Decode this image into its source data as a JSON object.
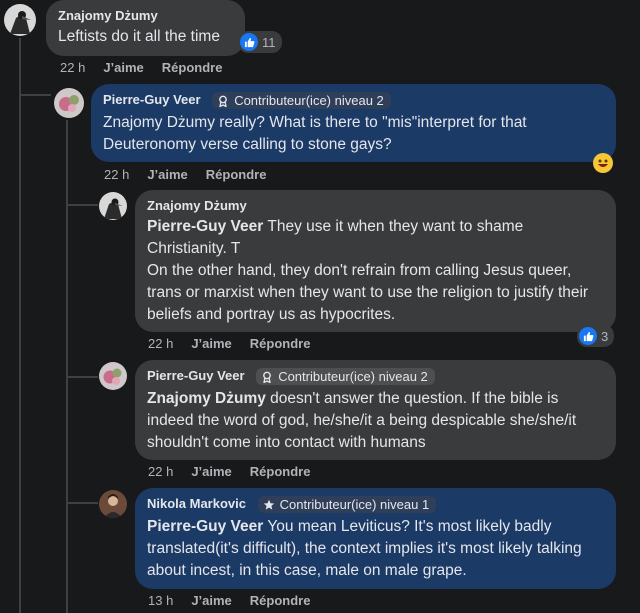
{
  "comments": [
    {
      "author": "Znajomy Dżumy",
      "text": "Leftists do it all the time",
      "time": "22 h",
      "like": "J’aime",
      "reply": "Répondre",
      "reactions": "11"
    },
    {
      "author": "Pierre-Guy Veer",
      "badge": "Contributeur(ice) niveau 2",
      "text": "Znajomy Dżumy really? What is there to \"mis\"interpret for that Deuteronomy verse calling to stone gays?",
      "time": "22 h",
      "like": "J’aime",
      "reply": "Répondre"
    },
    {
      "author": "Znajomy Dżumy",
      "mention": "Pierre-Guy Veer",
      "text_line1": " They use it when they want to shame Christianity. T",
      "text_line2": "On the other hand, they don't refrain from calling Jesus queer, trans or marxist when they want to use the religion to justify their beliefs and portray us as hypocrites.",
      "time": "22 h",
      "like": "J’aime",
      "reply": "Répondre",
      "reactions": "3"
    },
    {
      "author": "Pierre-Guy Veer",
      "badge": "Contributeur(ice) niveau 2",
      "mention": "Znajomy Dżumy",
      "text": " doesn't answer the question. If the bible is indeed the word of god, he/she/it a being despicable she/she/it shouldn't come into contact with humans",
      "time": "22 h",
      "like": "J’aime",
      "reply": "Répondre"
    },
    {
      "author": "Nikola Markovic",
      "badge": "Contributeur(ice) niveau 1",
      "mention": "Pierre-Guy Veer",
      "text": " You mean Leviticus? It's most likely badly translated(it's difficult), the context implies it's most likely talking about incest, in this case, male on male grape.",
      "time": "13 h",
      "like": "J’aime",
      "reply": "Répondre"
    }
  ],
  "colors": {
    "background": "#18191a",
    "bubble_dark": "#3a3b3c",
    "bubble_highlight": "#1b3a66",
    "like_blue": "#1877f2"
  },
  "icons": {
    "badge_level2": "award-ribbon-icon",
    "badge_level1": "star-icon",
    "reaction": "thumbs-up-icon",
    "emoji": "grinning-emoji-icon"
  }
}
